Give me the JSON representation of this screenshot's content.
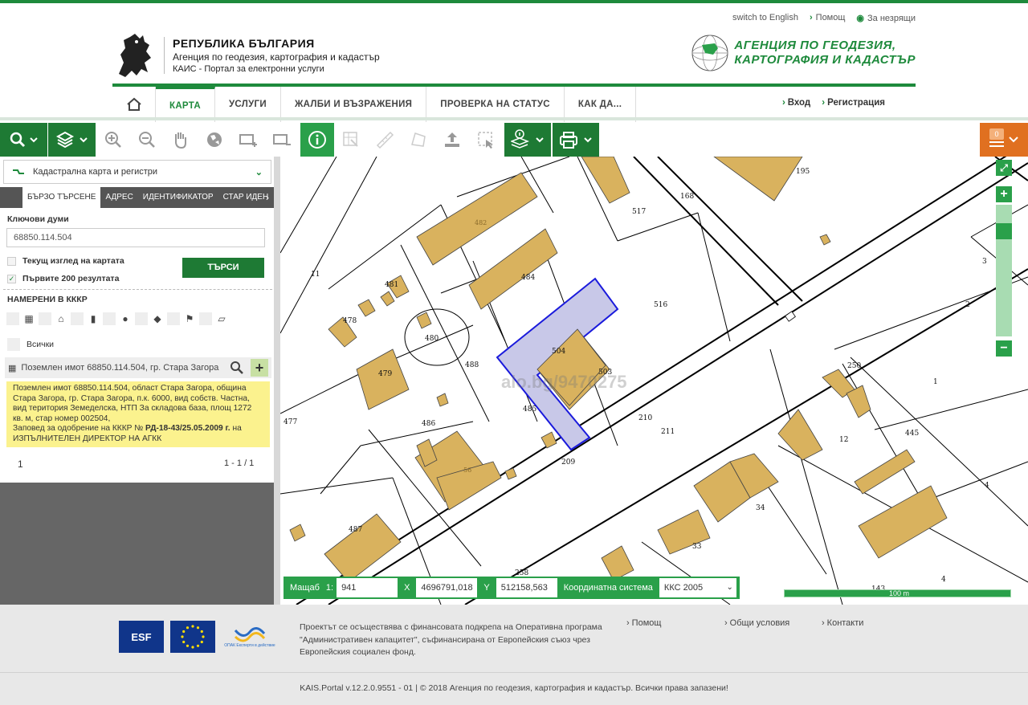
{
  "top_links": {
    "switch_lang": "switch to English",
    "help": "Помощ",
    "accessibility": "За незрящи"
  },
  "brand": {
    "line1": "РЕПУБЛИКА БЪЛГАРИЯ",
    "line2": "Агенция по геодезия, картография и кадастър",
    "line3": "КАИС - Портал за електронни услуги",
    "agency_line1": "АГЕНЦИЯ ПО ГЕОДЕЗИЯ,",
    "agency_line2": "КАРТОГРАФИЯ И КАДАСТЪР"
  },
  "nav": {
    "items": [
      "КАРТА",
      "УСЛУГИ",
      "ЖАЛБИ И ВЪЗРАЖЕНИЯ",
      "ПРОВЕРКА НА СТАТУС",
      "КАК ДА..."
    ],
    "active": "КАРТА"
  },
  "auth": {
    "login": "Вход",
    "register": "Регистрация"
  },
  "toolbar": {
    "cart_count": "0"
  },
  "panel": {
    "layer": "Кадастрална карта и регистри",
    "tabs": [
      "БЪРЗО ТЪРСЕНЕ",
      "АДРЕС",
      "ИДЕНТИФИКАТОР",
      "СТАР ИДЕН"
    ],
    "keywords_label": "Ключови думи",
    "keywords_value": "68850.114.504",
    "current_view": "Текущ изглед на картата",
    "first_200": "Първите 200 резултата",
    "search_button": "ТЪРСИ",
    "found_label": "НАМЕРЕНИ В КККР",
    "all_label": "Всички",
    "result_title": "Поземлен имот 68850.114.504, гр. Стара Загора",
    "result_text": "Поземлен имот 68850.114.504, област Стара Загора, община Стара Загора, гр. Стара Загора, п.к. 6000, вид собств. Частна, вид територия Земеделска, НТП За складова база, площ 1272 кв. м, стар номер 002504,",
    "result_order_prefix": "Заповед за одобрение на КККР №",
    "result_order_bold": "РД-18-43/25.05.2009 г.",
    "result_order_suffix": "на ИЗПЪЛНИТЕЛЕН ДИРЕКТОР НА АГКК",
    "page_number": "1",
    "page_info": "1 - 1 / 1"
  },
  "map": {
    "watermark": "alo.bg/9470275",
    "scale_label": "Мащаб",
    "scale_prefix": "1:",
    "scale_value": "941",
    "x_label": "X",
    "x_value": "4696791,018",
    "y_label": "Y",
    "y_value": "512158,563",
    "crs_label": "Координатна система",
    "crs_value": "ККС 2005",
    "scalebar_label": "100 m",
    "parcel_labels": [
      "195",
      "168",
      "517",
      "3",
      "2",
      "11",
      "481",
      "484",
      "516",
      "478",
      "480",
      "479",
      "488",
      "504",
      "503",
      "1",
      "250",
      "477",
      "486",
      "485",
      "210",
      "211",
      "445",
      "12",
      "209",
      "34",
      "4",
      "487",
      "33",
      "258",
      "143",
      "4",
      "56",
      "482"
    ]
  },
  "footer": {
    "project_text": "Проектът се осъществява с финансовата подкрепа на Оперативна програма \"Административен капацитет\", съфинансирана от Европейския съюз чрез Европейския социален фонд.",
    "links": [
      "Помощ",
      "Общи условия",
      "Контакти"
    ],
    "copyright": "KAIS.Portal v.12.2.0.9551 - 01  |  © 2018 Агенция по геодезия, картография и кадастър. Всички права запазени!",
    "logo_esf": "ESF",
    "logo_opak": "ОПАК Експерти в действие"
  },
  "colors": {
    "accent": "#1e8a3c",
    "building": "#d9b25e",
    "selected_parcel": "#c8c8e8"
  }
}
